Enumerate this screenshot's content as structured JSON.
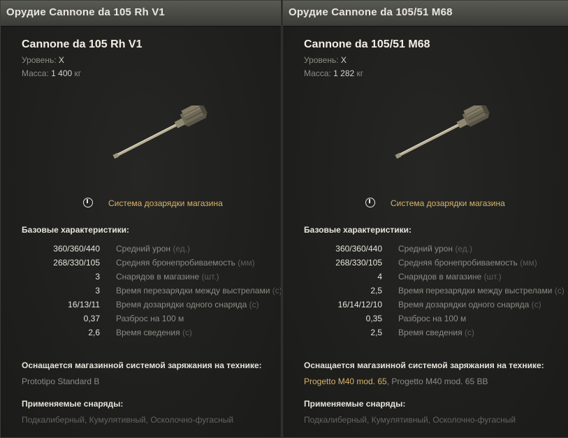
{
  "panels": [
    {
      "window_title": "Орудие Cannone da 105 Rh V1",
      "name": "Cannone da 105 Rh V1",
      "level_label": "Уровень:",
      "level_value": "X",
      "mass_label": "Масса:",
      "mass_value": "1 400",
      "mass_unit": "кг",
      "feature": "Система дозарядки магазина",
      "base_heading": "Базовые характеристики:",
      "stats": [
        {
          "value": "360/360/440",
          "label": "Средний урон",
          "unit": "(ед.)"
        },
        {
          "value": "268/330/105",
          "label": "Средняя бронепробиваемость",
          "unit": "(мм)"
        },
        {
          "value": "3",
          "label": "Снарядов в магазине",
          "unit": "(шт.)"
        },
        {
          "value": "3",
          "label": "Время перезарядки между выстрелами",
          "unit": "(с)"
        },
        {
          "value": "16/13/11",
          "label": "Время дозарядки одного снаряда",
          "unit": "(с)"
        },
        {
          "value": "0,37",
          "label": "Разброс на 100 м",
          "unit": ""
        },
        {
          "value": "2,6",
          "label": "Время сведения",
          "unit": "(с)"
        }
      ],
      "vehicles_heading": "Оснащается магазинной системой заряжания на технике:",
      "vehicles": "Prototipo Standard B",
      "ammo_heading": "Применяемые снаряды:",
      "ammo": "Подкалиберный, Кумулятивный, Осколочно-фугасный"
    },
    {
      "window_title": "Орудие Cannone da 105/51 M68",
      "name": "Cannone da 105/51 M68",
      "level_label": "Уровень:",
      "level_value": "X",
      "mass_label": "Масса:",
      "mass_value": "1 282",
      "mass_unit": "кг",
      "feature": "Система дозарядки магазина",
      "base_heading": "Базовые характеристики:",
      "stats": [
        {
          "value": "360/360/440",
          "label": "Средний урон",
          "unit": "(ед.)"
        },
        {
          "value": "268/330/105",
          "label": "Средняя бронепробиваемость",
          "unit": "(мм)"
        },
        {
          "value": "4",
          "label": "Снарядов в магазине",
          "unit": "(шт.)"
        },
        {
          "value": "2,5",
          "label": "Время перезарядки между выстрелами",
          "unit": "(с)"
        },
        {
          "value": "16/14/12/10",
          "label": "Время дозарядки одного снаряда",
          "unit": "(с)"
        },
        {
          "value": "0,35",
          "label": "Разброс на 100 м",
          "unit": ""
        },
        {
          "value": "2,5",
          "label": "Время сведения",
          "unit": "(с)"
        }
      ],
      "vehicles_heading": "Оснащается магазинной системой заряжания на технике:",
      "vehicles_list": [
        "Progetto M40 mod. 65",
        "Progetto M40 mod. 65 BB"
      ],
      "vehicles_sep": ", ",
      "ammo_heading": "Применяемые снаряды:",
      "ammo": "Подкалиберный, Кумулятивный, Осколочно-фугасный"
    }
  ],
  "colors": {
    "accent_gold": "#d6b46a",
    "text_light": "#e6e3da",
    "text_muted": "#8d8b84"
  },
  "icons": {
    "feature": "magazine-reload-icon",
    "gun": "gun-model-image"
  }
}
